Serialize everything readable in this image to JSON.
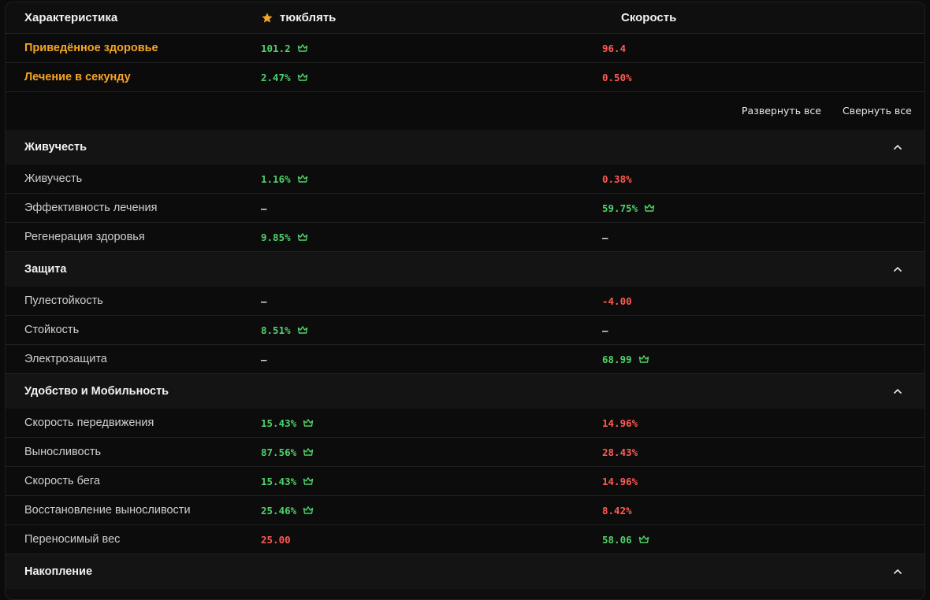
{
  "header": {
    "characteristic_label": "Характеристика",
    "col_a_label": "тюкблять",
    "col_b_label": "Скорость"
  },
  "icons": {
    "star": "star-icon",
    "crown": "crown-icon",
    "chevron": "chevron-up-icon"
  },
  "colors": {
    "accent": "#f5a524",
    "good": "#4fd16a",
    "bad": "#ff5a52"
  },
  "main_stats": [
    {
      "name": "Приведённое здоровье",
      "a": "101.2",
      "a_status": "good",
      "a_crown": true,
      "b": "96.4",
      "b_status": "bad",
      "b_crown": false
    },
    {
      "name": "Лечение в секунду",
      "a": "2.47%",
      "a_status": "good",
      "a_crown": true,
      "b": "0.50%",
      "b_status": "bad",
      "b_crown": false
    }
  ],
  "controls": {
    "expand_all": "Развернуть все",
    "collapse_all": "Свернуть все"
  },
  "sections": [
    {
      "title": "Живучесть",
      "rows": [
        {
          "name": "Живучесть",
          "a": "1.16%",
          "a_status": "good",
          "a_crown": true,
          "b": "0.38%",
          "b_status": "bad",
          "b_crown": false
        },
        {
          "name": "Эффективность лечения",
          "a": "–",
          "a_status": "none",
          "a_crown": false,
          "b": "59.75%",
          "b_status": "good",
          "b_crown": true
        },
        {
          "name": "Регенерация здоровья",
          "a": "9.85%",
          "a_status": "good",
          "a_crown": true,
          "b": "–",
          "b_status": "none",
          "b_crown": false
        }
      ]
    },
    {
      "title": "Защита",
      "rows": [
        {
          "name": "Пулестойкость",
          "a": "–",
          "a_status": "none",
          "a_crown": false,
          "b": "-4.00",
          "b_status": "bad",
          "b_crown": false
        },
        {
          "name": "Стойкость",
          "a": "8.51%",
          "a_status": "good",
          "a_crown": true,
          "b": "–",
          "b_status": "none",
          "b_crown": false
        },
        {
          "name": "Электрозащита",
          "a": "–",
          "a_status": "none",
          "a_crown": false,
          "b": "68.99",
          "b_status": "good",
          "b_crown": true
        }
      ]
    },
    {
      "title": "Удобство и Мобильность",
      "rows": [
        {
          "name": "Скорость передвижения",
          "a": "15.43%",
          "a_status": "good",
          "a_crown": true,
          "b": "14.96%",
          "b_status": "bad",
          "b_crown": false
        },
        {
          "name": "Выносливость",
          "a": "87.56%",
          "a_status": "good",
          "a_crown": true,
          "b": "28.43%",
          "b_status": "bad",
          "b_crown": false
        },
        {
          "name": "Скорость бега",
          "a": "15.43%",
          "a_status": "good",
          "a_crown": true,
          "b": "14.96%",
          "b_status": "bad",
          "b_crown": false
        },
        {
          "name": "Восстановление выносливости",
          "a": "25.46%",
          "a_status": "good",
          "a_crown": true,
          "b": "8.42%",
          "b_status": "bad",
          "b_crown": false
        },
        {
          "name": "Переносимый вес",
          "a": "25.00",
          "a_status": "bad",
          "a_crown": false,
          "b": "58.06",
          "b_status": "good",
          "b_crown": true
        }
      ]
    },
    {
      "title": "Накопление",
      "rows": []
    }
  ]
}
